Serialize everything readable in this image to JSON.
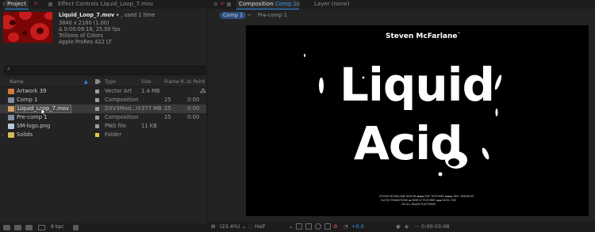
{
  "project_panel": {
    "tabs": {
      "project": "Project",
      "effect_controls_prefix": "Effect Controls",
      "effect_controls_file": "Liquid_Loop_7.mov"
    },
    "footage_info": {
      "name": "Liquid_Loop_7.mov",
      "used": ", used 1 time",
      "resolution": "3840 x 2160 (1.00)",
      "duration": "Δ 0:00:09:18, 25.00 fps",
      "colors": "Trillions of Colors",
      "codec": "Apple ProRes 422 LT"
    },
    "search": {
      "icon": "search-icon",
      "placeholder": ""
    },
    "columns": {
      "name": "Name",
      "type": "Type",
      "size": "Size",
      "frame_rate": "Frame R...",
      "in_point": "In Point"
    },
    "items": [
      {
        "name": "Artwork 39",
        "icon": "vector-art-icon",
        "icon_color": "#d47a3a",
        "label_color": "#9d9d9d",
        "type": "Vector Art",
        "size": "1.4 MB",
        "frame_rate": "",
        "in_point": ""
      },
      {
        "name": "Comp 1",
        "icon": "composition-icon",
        "icon_color": "#7f8fa3",
        "label_color": "#9d9d9d",
        "type": "Composition",
        "size": "",
        "frame_rate": "25",
        "in_point": "0:00"
      },
      {
        "name": "Liquid_Loop_7.mov",
        "icon": "footage-icon",
        "icon_color": "#d8a060",
        "label_color": "#9d9d9d",
        "type": "DXV3Mod...rt",
        "size": "377 MB",
        "frame_rate": "25",
        "in_point": "0:00",
        "selected": true
      },
      {
        "name": "Pre-comp 1",
        "icon": "composition-icon",
        "icon_color": "#7f8fa3",
        "label_color": "#9d9d9d",
        "type": "Composition",
        "size": "",
        "frame_rate": "25",
        "in_point": "0:00"
      },
      {
        "name": "SM-logo.png",
        "icon": "png-file-icon",
        "icon_color": "#b5c9dd",
        "label_color": "#9d9d9d",
        "type": "PNG file",
        "size": "11 KB",
        "frame_rate": "",
        "in_point": ""
      },
      {
        "name": "Solids",
        "icon": "folder-icon",
        "icon_color": "#d6b956",
        "label_color": "#e0c84a",
        "type": "Folder",
        "size": "",
        "frame_rate": "",
        "in_point": ""
      }
    ],
    "bottom": {
      "bpc": "8 bpc"
    }
  },
  "viewer": {
    "tabs": {
      "composition_prefix": "Composition",
      "composition_name": "Comp 1",
      "layer": "Layer (none)"
    },
    "subtabs": [
      "Comp 1",
      "Pre-comp 1"
    ],
    "canvas": {
      "brand": "Steven McFarlane",
      "trademark": "™",
      "title_line1": "Liquid",
      "title_line2": "Acid",
      "credits_line1": "STEVEN MCFARLANE DESIGN ▬▬▬ FIVE TEXTURES ▬▬▬ 180+ WORDLIST",
      "credits_line2": "GLITCH TRANSITIONS ▬ GENTLE TEXTURES ▬▬ EXCEL FIVE",
      "credits_line3": "ON ALL MAJOR PLATFORMS"
    },
    "toolbar": {
      "zoom": "(23.4%)",
      "resolution": "Half",
      "exposure": "+0.0",
      "timecode": "0:00:03:08"
    },
    "accent": "#2d8ceb"
  }
}
